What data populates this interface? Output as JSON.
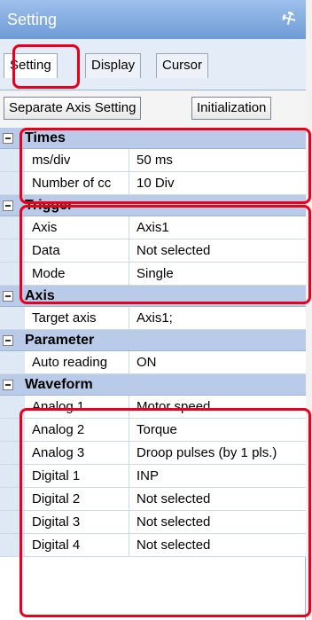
{
  "window": {
    "title": "Setting"
  },
  "tabs": [
    {
      "label": "Setting"
    },
    {
      "label": "Display"
    },
    {
      "label": "Cursor"
    }
  ],
  "toolbar": {
    "separate_axis_label": "Separate Axis Setting",
    "initialization_label": "Initialization"
  },
  "sections": {
    "times": {
      "title": "Times",
      "rows": [
        {
          "name": "ms/div",
          "value": "50 ms"
        },
        {
          "name": "Number of cc",
          "value": "10 Div"
        }
      ]
    },
    "trigger": {
      "title": "Trigger",
      "rows": [
        {
          "name": "Axis",
          "value": "Axis1"
        },
        {
          "name": "Data",
          "value": "Not selected"
        },
        {
          "name": "Mode",
          "value": "Single"
        }
      ]
    },
    "axis": {
      "title": "Axis",
      "rows": [
        {
          "name": "Target axis",
          "value": "Axis1;"
        }
      ]
    },
    "parameter": {
      "title": "Parameter",
      "rows": [
        {
          "name": "Auto reading",
          "value": "ON"
        }
      ]
    },
    "waveform": {
      "title": "Waveform",
      "rows": [
        {
          "name": "Analog 1",
          "value": "Motor speed"
        },
        {
          "name": "Analog 2",
          "value": "Torque"
        },
        {
          "name": "Analog 3",
          "value": "Droop pulses (by 1 pls.)"
        },
        {
          "name": "Digital 1",
          "value": "INP"
        },
        {
          "name": "Digital 2",
          "value": "Not selected"
        },
        {
          "name": "Digital 3",
          "value": "Not selected"
        },
        {
          "name": "Digital 4",
          "value": "Not selected"
        }
      ]
    }
  },
  "colors": {
    "highlight": "#e8001c",
    "titlebar": "#7fa7dc",
    "section_header": "#b9cbe8"
  }
}
